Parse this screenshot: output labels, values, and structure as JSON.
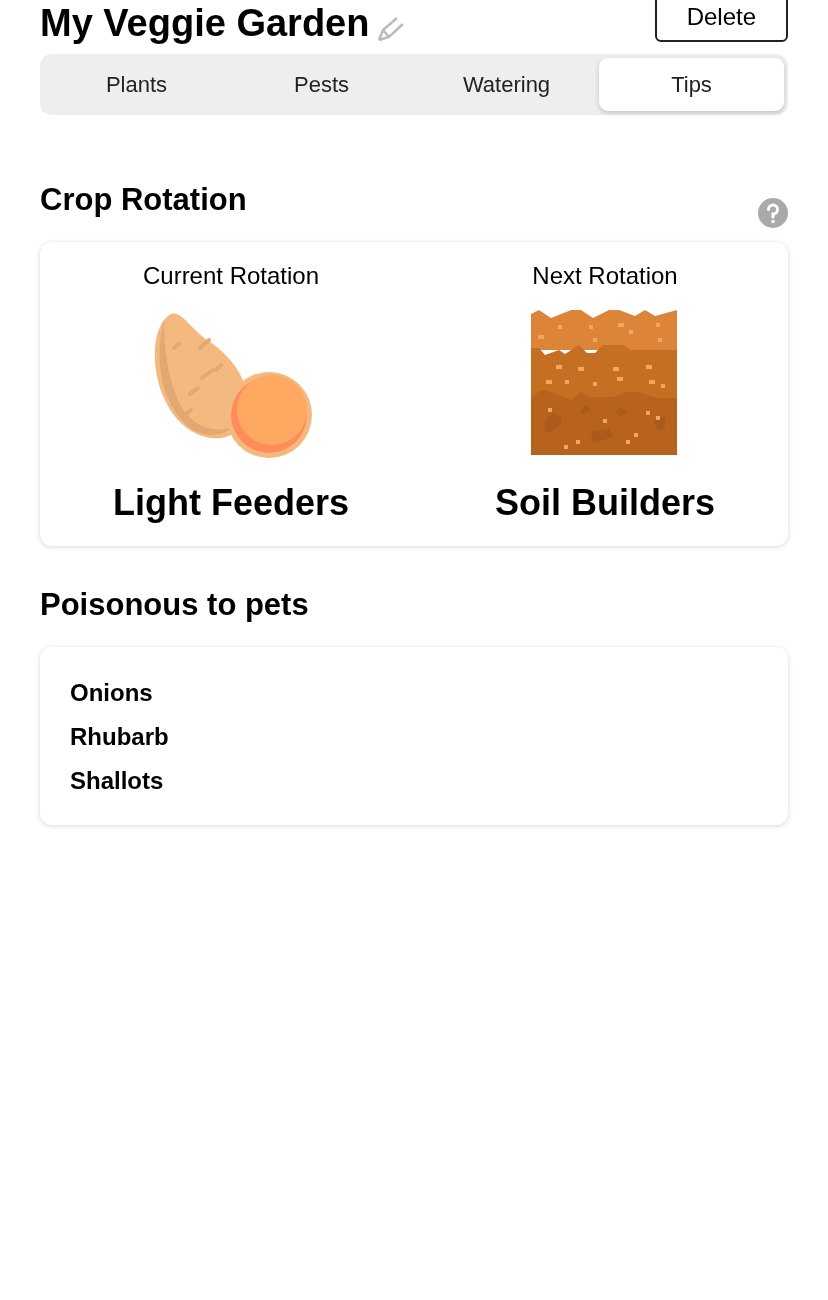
{
  "header": {
    "title": "My Veggie Garden",
    "delete_button": "Delete"
  },
  "tabs": [
    {
      "label": "Plants",
      "selected": false
    },
    {
      "label": "Pests",
      "selected": false
    },
    {
      "label": "Watering",
      "selected": false
    },
    {
      "label": "Tips",
      "selected": true
    }
  ],
  "crop_rotation": {
    "title": "Crop Rotation",
    "columns": [
      {
        "caption": "Current Rotation",
        "kind": "sweet-potato",
        "name": "Light Feeders"
      },
      {
        "caption": "Next Rotation",
        "kind": "soil",
        "name": "Soil Builders"
      }
    ]
  },
  "poisonous": {
    "title": "Poisonous to pets",
    "items": [
      "Onions",
      "Rhubarb",
      "Shallots"
    ]
  }
}
